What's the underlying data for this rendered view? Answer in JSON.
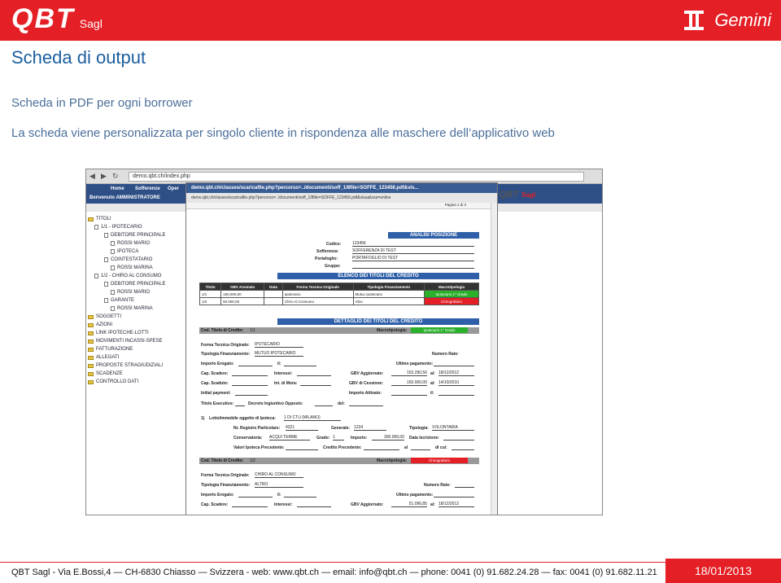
{
  "header": {
    "brand": "QBT",
    "brand_suffix": "Sagl",
    "product": "Gemini"
  },
  "slide": {
    "title": "Scheda di output",
    "subtitle1": "Scheda in PDF per ogni borrower",
    "subtitle2": "La scheda viene personalizzata per singolo cliente in rispondenza alle maschere dell’applicativo web"
  },
  "browser": {
    "url": "demo.qbt.ch/index.php"
  },
  "app": {
    "nav_tabs": [
      "Home",
      "Sofferenze",
      "Oper"
    ],
    "admin_label": "Benvenuto AMMINISTRATORE",
    "logo": "QBT",
    "logo_suffix": "Sagl",
    "tree": [
      "TITOLI",
      "1/1 - IPOTECARIO",
      "DEBITORE PRINCIPALE",
      "ROSSI MARIO",
      "IPOTECA",
      "COINTESTATARIO",
      "ROSSI MARINA",
      "1/2 - CHIRO AL CONSUMO",
      "DEBITORE PRINCIPALE",
      "ROSSI MARIO",
      "GARANTE",
      "ROSSI MARINA",
      "SOGGETTI",
      "AZIONI",
      "LINK IPOTECHE-LOTTI",
      "MOVIMENTI INCASSI-SPESE",
      "FATTURAZIONE",
      "ALLEGATI",
      "PROPOSTE STRAGIUDIZIALI",
      "SCADENZE",
      "CONTROLLO DATI"
    ]
  },
  "pdf": {
    "window_title": "demo.qbt.ch/classes/scaricafile.php?percorso=../documenti/soff_1/8file=SOFFE_123456.pdf&vis...",
    "url": "demo.qbt.ch/classes/scaricafile.php?percorso=../documenti/soff_1/8file=SOFFE_123456.pdf&visualizza=online",
    "page_counter": "Pagina 1 di 3",
    "band_analisi": "ANALISI POSIZIONE",
    "codice_lbl": "Codice:",
    "codice_val": "123456",
    "soff_lbl": "Sofferenza:",
    "soff_val": "SOFFERENZA DI TEST",
    "port_lbl": "Portafoglio:",
    "port_val": "PORTAFOGLIO DI TEST",
    "gruppo_lbl": "Gruppo:",
    "band_elenco": "ELENCO DEI TITOLI DEL CREDITO",
    "table_headers": [
      "Titolo",
      "GBV Anomalo",
      "Data",
      "Forma Tecnica Originale",
      "Tipologia Finanziamento",
      "Macrotipologia"
    ],
    "table_rows": [
      [
        "1/1",
        "150.000,00",
        "",
        "Ipotecario",
        "Mutuo Ipotecario",
        "Ipotecario 1° Grado"
      ],
      [
        "1/2",
        "50.000,00",
        "",
        "Chiro Al Consumo",
        "Altro",
        "Chirografario"
      ]
    ],
    "band_dettaglio": "DETTAGLIO DEI TITOLI DEL CREDITO",
    "cod_titolo_lbl": "Cod. Titolo di Credito:",
    "cod_titolo_val": "1/1",
    "macro_lbl": "Macrotipologia:",
    "macro_val": "Ipotecario 1° Grado",
    "forma_lbl": "Forma Tecnica Originale:",
    "forma_val": "IPOTECARIO",
    "tipfin_lbl": "Tipologia Finanziamento:",
    "tipfin_val": "MUTUO IPOTECARIO",
    "numrate_lbl": "Numero Rate:",
    "imp_erog_lbl": "Importo Erogato:",
    "il_lbl": "il:",
    "ultimo_pag_lbl": "Ultimo pagamento:",
    "cap_scad_lbl": "Cap. Scadere:",
    "interessi_lbl": "Interessi:",
    "gbv_agg_lbl": "GBV Aggiornato:",
    "gbv_agg_val": "153.290,56",
    "al_lbl": "al:",
    "al1_val": "18/12/2012",
    "cap_scad2_lbl": "Cap. Scaduto:",
    "int_mora_lbl": "Int. di Mora:",
    "gbv_cess_lbl": "GBV di Cessione:",
    "gbv_cess_val": "150.000,00",
    "al2_val": "14/10/2010",
    "init_pay_lbl": "Initial payment:",
    "imp_att_lbl": "Importo Attivato:",
    "tit_esec_lbl": "Titolo Esecutivo:",
    "decreto_lbl": "Decreto Ingiuntivo Opposto:",
    "del_lbl": "del:",
    "lotto_num": "1)",
    "lotto_lbl": "Lotto/immobile oggetto di Ipoteca:",
    "lotto_val": "1 DI CTU (MILANO)",
    "nreg_lbl": "Nr. Registro Particolare:",
    "nreg_val": "4321",
    "gen_lbl": "Generale:",
    "gen_val": "1234",
    "tipologia_lbl": "Tipologia:",
    "tipologia_val": "VOLONTARIA",
    "conserv_lbl": "Conservatoria:",
    "conserv_val": "ACQUI TERME",
    "grado_lbl": "Grado:",
    "grado_val": "1",
    "importo_lbl": "Importo:",
    "importo_val": "300.000,00",
    "data_iscr_lbl": "Data Iscrizione:",
    "valori_lbl": "Valori Ipoteca Precedente:",
    "credito_prec_lbl": "Credito Precedente:",
    "al3_lbl": "al",
    "di_cui_lbl": "di cui:",
    "cod_titolo2_val": "1/2",
    "macro2_val": "Chirografario",
    "forma2_val": "CHIRO AL CONSUMO",
    "tipfin2_val": "ALTRO",
    "gbv_agg2_val": "51.096,85",
    "al4_val": "18/12/2012"
  },
  "footer": {
    "info": "QBT Sagl  - Via E.Bossi,4 — CH-6830 Chiasso — Svizzera - web: www.qbt.ch — email: info@qbt.ch — phone: 0041 (0) 91.682.24.28 — fax: 0041 (0) 91.682.11.21",
    "date": "18/01/2013"
  },
  "colors": {
    "brand_red": "#e41f25",
    "title_blue": "#1b5e9e",
    "band_blue": "#2e5fa8"
  }
}
